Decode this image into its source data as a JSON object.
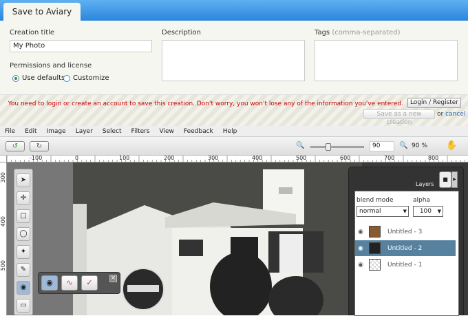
{
  "header": {
    "tab_title": "Save to Aviary"
  },
  "form": {
    "creation_title_label": "Creation title",
    "creation_title_value": "My Photo",
    "description_label": "Description",
    "tags_label": "Tags",
    "tags_hint": "(comma-separated)",
    "permissions_label": "Permissions and license",
    "use_defaults": "Use defaults",
    "customize": "Customize"
  },
  "notice": {
    "message": "You need to login or create an account to save this creation. Don't worry, you won't lose any of the information you've entered.",
    "login_button": "Login / Register",
    "save_new_button": "Save as a new creation",
    "or_text": "or",
    "cancel_link": "cancel"
  },
  "menu": [
    "File",
    "Edit",
    "Image",
    "Layer",
    "Select",
    "Filters",
    "View",
    "Feedback",
    "Help"
  ],
  "toolbar": {
    "zoom_input": "90",
    "zoom_label": "90 %",
    "zoom_level": 0.3
  },
  "ruler": {
    "h": [
      "-100",
      "0",
      "100",
      "200",
      "300",
      "400",
      "500",
      "600",
      "700",
      "800"
    ],
    "v": [
      "300",
      "400",
      "500"
    ]
  },
  "layers": {
    "title": "Layers",
    "blend_mode_label": "blend mode",
    "alpha_label": "alpha",
    "blend_mode_value": "normal",
    "alpha_value": "100",
    "items": [
      {
        "name": "Untitled - 3",
        "color": "#8a5a30"
      },
      {
        "name": "Untitled - 2",
        "color": "#222"
      },
      {
        "name": "Untitled - 1",
        "color": "#fff"
      }
    ]
  }
}
